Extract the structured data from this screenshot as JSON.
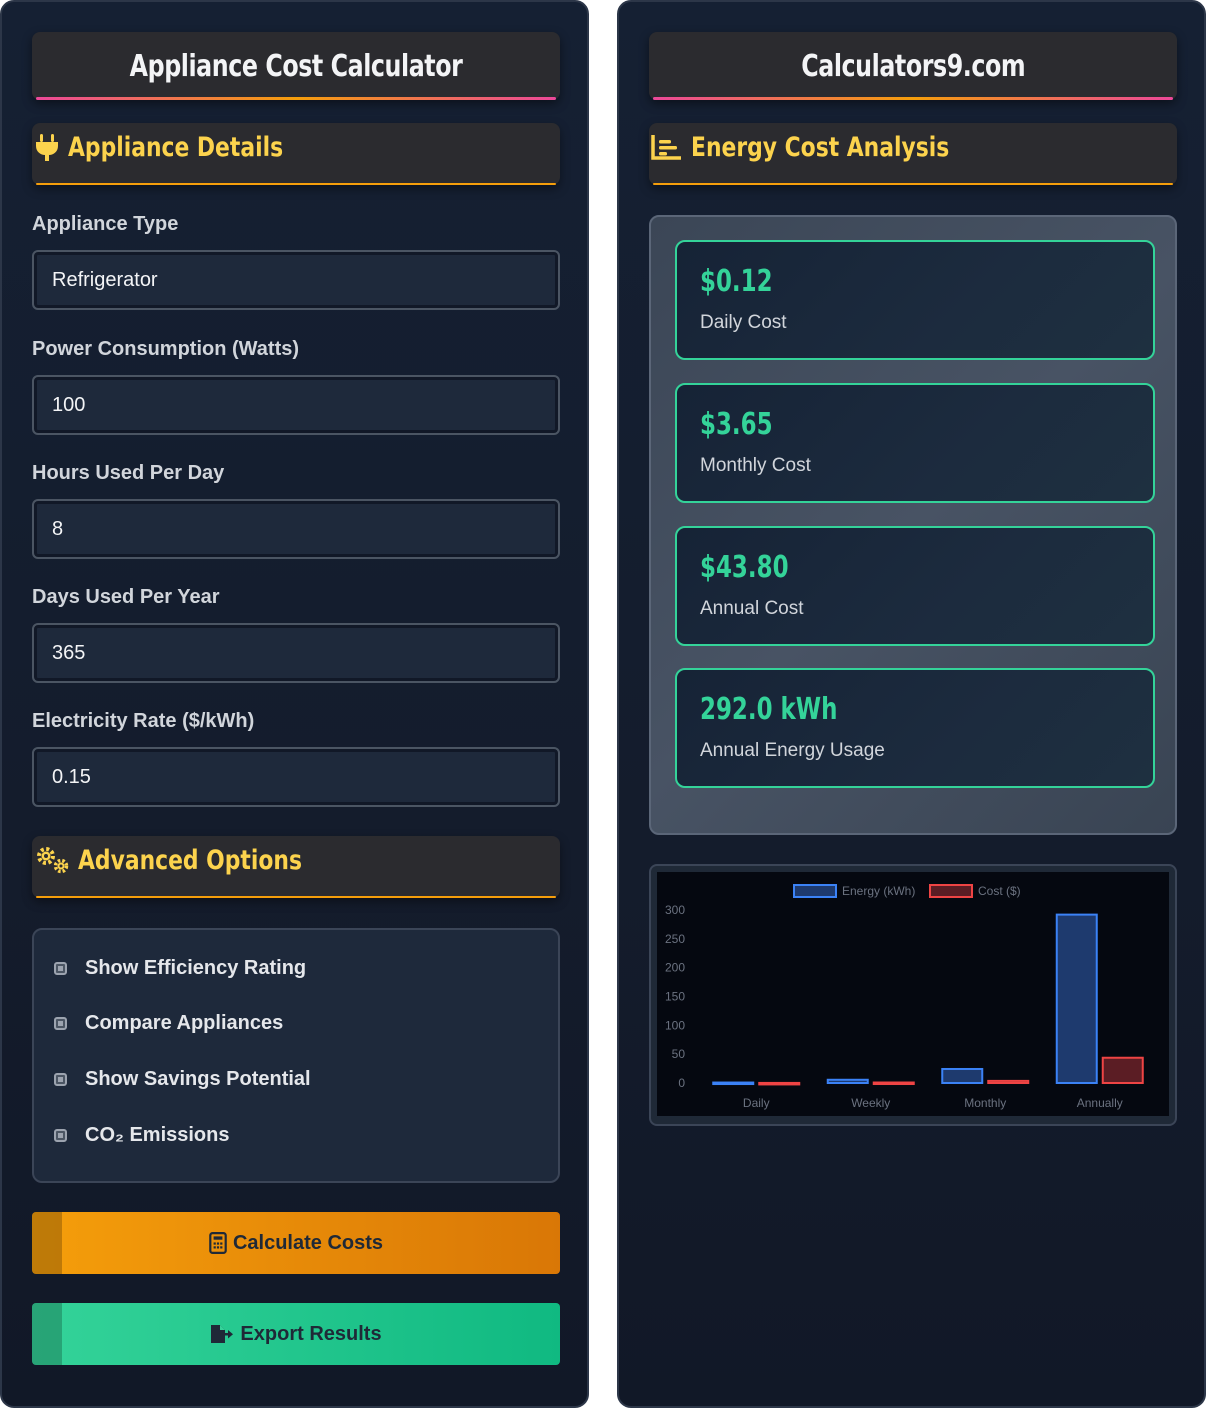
{
  "left": {
    "header_title": "Appliance Cost Calculator",
    "details_title": "Appliance Details",
    "fields": [
      {
        "label": "Appliance Type",
        "value": "Refrigerator"
      },
      {
        "label": "Power Consumption (Watts)",
        "value": "100"
      },
      {
        "label": "Hours Used Per Day",
        "value": "8"
      },
      {
        "label": "Days Used Per Year",
        "value": "365"
      },
      {
        "label": "Electricity Rate ($/kWh)",
        "value": "0.15"
      }
    ],
    "advanced_title": "Advanced Options",
    "options": [
      {
        "label": "Show Efficiency Rating"
      },
      {
        "label": "Compare Appliances"
      },
      {
        "label": "Show Savings Potential"
      },
      {
        "label": "CO₂ Emissions"
      }
    ],
    "calculate_label": "Calculate Costs",
    "export_label": "Export Results"
  },
  "right": {
    "header_title": "Calculators9.com",
    "analysis_title": "Energy Cost Analysis",
    "results": [
      {
        "value": "$0.12",
        "label": "Daily Cost"
      },
      {
        "value": "$3.65",
        "label": "Monthly Cost"
      },
      {
        "value": "$43.80",
        "label": "Annual Cost"
      },
      {
        "value": "292.0 kWh",
        "label": "Annual Energy Usage"
      }
    ]
  },
  "colors": {
    "accent_gold": "#fcd34d",
    "accent_green": "#34d399",
    "energy_series": "#3b82f6",
    "cost_series": "#ef4444"
  },
  "chart_data": {
    "type": "bar",
    "categories": [
      "Daily",
      "Weekly",
      "Monthly",
      "Annually"
    ],
    "series": [
      {
        "name": "Energy (kWh)",
        "values": [
          0.8,
          5.6,
          24.3,
          292.0
        ]
      },
      {
        "name": "Cost ($)",
        "values": [
          0.12,
          0.84,
          3.65,
          43.8
        ]
      }
    ],
    "yticks": [
      "0",
      "50",
      "100",
      "150",
      "200",
      "250",
      "300"
    ],
    "ylim": [
      0,
      300
    ],
    "legend": "top"
  }
}
